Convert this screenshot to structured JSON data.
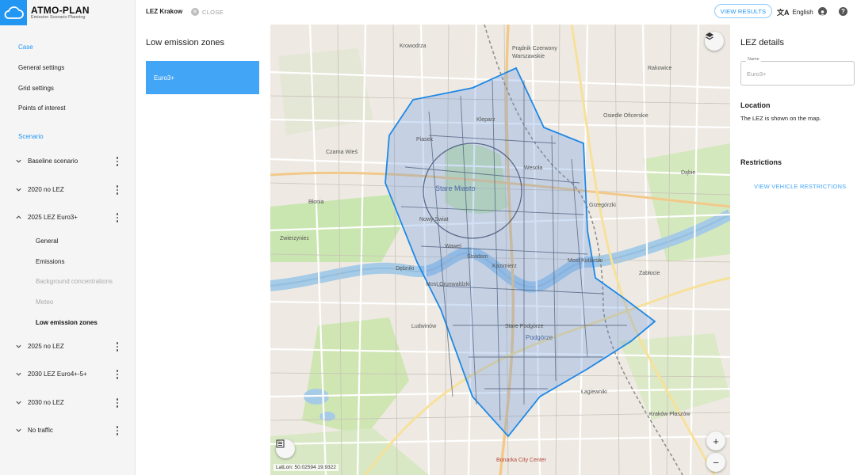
{
  "app": {
    "name": "ATMO-PLAN",
    "subtitle": "Emission Scenario Planning"
  },
  "sidebar": {
    "case_section": "Case",
    "case_links": [
      "General settings",
      "Grid settings",
      "Points of interest"
    ],
    "scenario_section": "Scenario",
    "scenarios": [
      {
        "label": "Baseline scenario",
        "expanded": false
      },
      {
        "label": "2020 no LEZ",
        "expanded": false
      },
      {
        "label": "2025 LEZ Euro3+",
        "expanded": true,
        "children": [
          {
            "label": "General",
            "state": "normal"
          },
          {
            "label": "Emissions",
            "state": "normal"
          },
          {
            "label": "Background concentrations",
            "state": "disabled"
          },
          {
            "label": "Meteo",
            "state": "disabled"
          },
          {
            "label": "Low emission zones",
            "state": "active"
          }
        ]
      },
      {
        "label": "2025 no LEZ",
        "expanded": false
      },
      {
        "label": "2030 LEZ Euro4+-5+",
        "expanded": false
      },
      {
        "label": "2030 no LEZ",
        "expanded": false
      },
      {
        "label": "No traffic",
        "expanded": false
      }
    ]
  },
  "topbar": {
    "case_title": "LEZ Krakow",
    "close_label": "CLOSE",
    "view_results_label": "VIEW RESULTS",
    "language": "English"
  },
  "lez_list": {
    "title": "Low emission zones",
    "items": [
      "Euro3+"
    ]
  },
  "map": {
    "latlon": "LatLon: 50.02594 19.9322",
    "place_labels": [
      "Krowodrza",
      "Prądnik Czerwony",
      "Warszawskie",
      "Osiedle Oficerskie",
      "Rakowice",
      "Kleparz",
      "Piasek",
      "Czarna Wieś",
      "Stare Miasto",
      "Wesoła",
      "Dąbie",
      "Błonia",
      "Nowy Świat",
      "Grzegórzki",
      "Zwierzyniec",
      "Wawel",
      "Stradom",
      "Kazimierz",
      "Most Kotlarski",
      "Most Grunwaldzki",
      "Zabłocie",
      "Dębniki",
      "Ludwinów",
      "Stare Podgórze",
      "Podgórze",
      "Łagiewniki",
      "Kraków Płaszów",
      "Bonarka City Center"
    ],
    "lez_color": "#1e88e5"
  },
  "details": {
    "title": "LEZ details",
    "name_label": "Name",
    "name_value": "Euro3+",
    "location_heading": "Location",
    "location_text": "The LEZ is shown on the map.",
    "restrictions_heading": "Restrictions",
    "view_restrictions_label": "VIEW VEHICLE RESTRICTIONS"
  }
}
